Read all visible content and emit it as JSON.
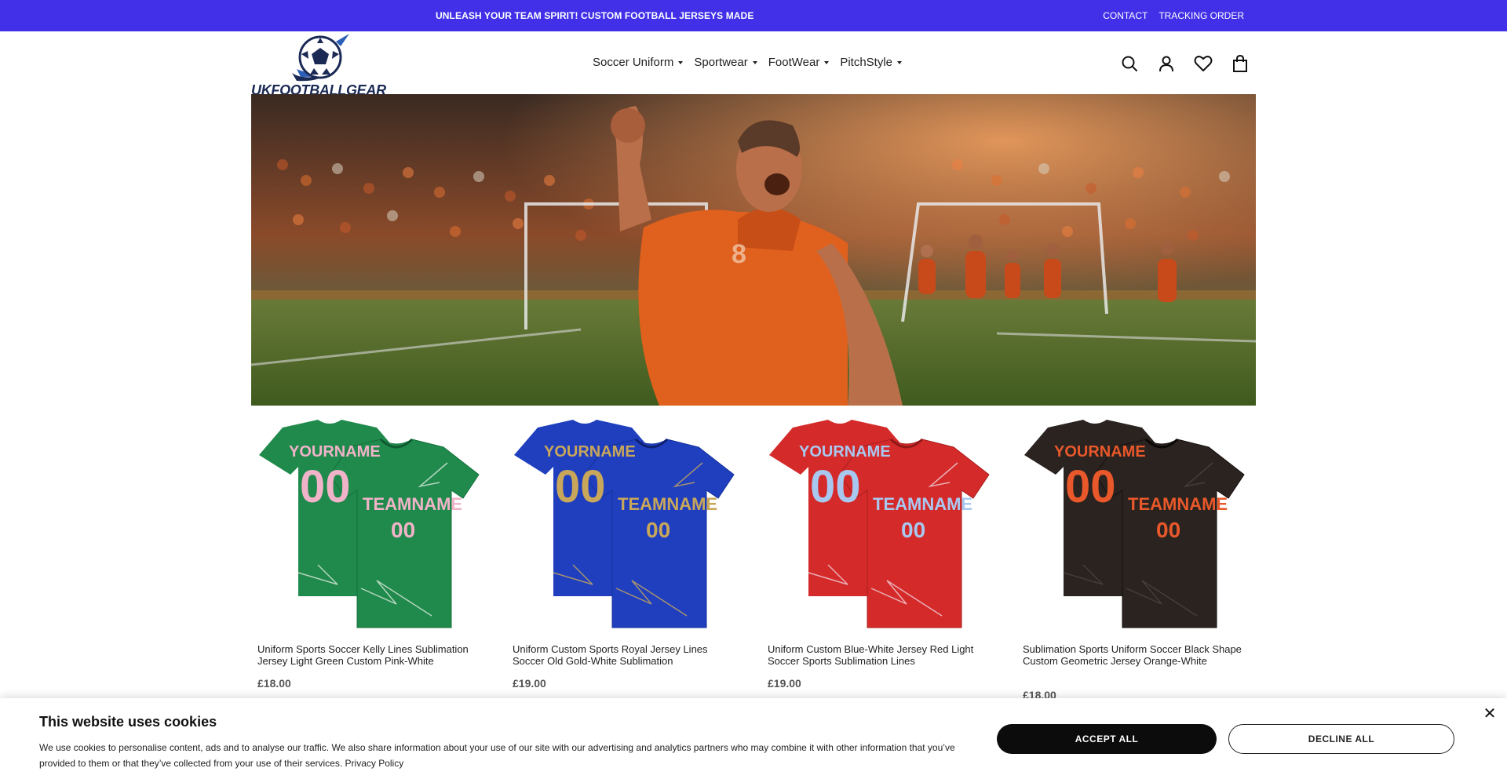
{
  "topbar": {
    "announcement": "UNLEASH YOUR TEAM SPIRIT! CUSTOM FOOTBALL JERSEYS MADE E",
    "links": [
      "CONTACT",
      "TRACKING ORDER"
    ],
    "bg_color": "#4130e8"
  },
  "header": {
    "logo_text": "UKFOOTBALLGEAR",
    "nav": [
      "Soccer Uniform",
      "Sportwear",
      "FootWear",
      "PitchStyle"
    ],
    "icons": [
      "search-icon",
      "account-icon",
      "wishlist-icon",
      "cart-icon"
    ]
  },
  "products": [
    {
      "title": "Uniform Sports Soccer Kelly Lines Sublimation Jersey Light Green Custom Pink-White",
      "price": "£18.00",
      "color": "#1f8a4c",
      "accent": "#f0b3c8",
      "name_text": "YOURNAME",
      "team_text": "TEAMNAME",
      "number": "00"
    },
    {
      "title": "Uniform Custom Sports Royal Jersey Lines Soccer Old Gold-White Sublimation",
      "price": "£19.00",
      "color": "#1f3fbf",
      "accent": "#c9a75a",
      "name_text": "YOURNAME",
      "team_text": "TEAMNAME",
      "number": "00"
    },
    {
      "title": "Uniform Custom Blue-White Jersey Red Light Soccer Sports Sublimation Lines",
      "price": "£19.00",
      "color": "#d42a2a",
      "accent": "#a9c8f0",
      "name_text": "YOURNAME",
      "team_text": "TEAMNAME",
      "number": "00"
    },
    {
      "title": "Sublimation Sports Uniform Soccer Black Shape Custom Geometric Jersey Orange-White",
      "price": "£18.00",
      "color": "#2a2320",
      "accent": "#e8582a",
      "name_text": "YOURNAME",
      "team_text": "TEAMNAME",
      "number": "00"
    }
  ],
  "cookie": {
    "title": "This website uses cookies",
    "text": "We use cookies to personalise content, ads and to analyse our traffic. We also share information about your use of our site with our advertising and analytics partners who may combine it with other information that you’ve provided to them or that they’ve collected from your use of their services.",
    "policy_link": "Privacy Policy",
    "accept": "ACCEPT ALL",
    "decline": "DECLINE ALL",
    "close": "✕"
  }
}
